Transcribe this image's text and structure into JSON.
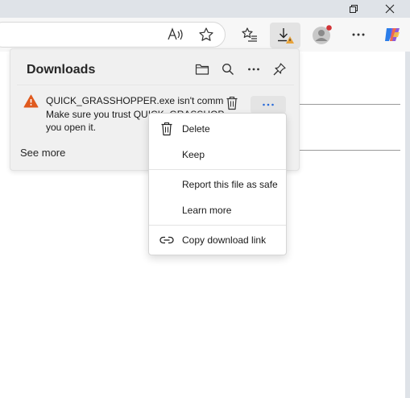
{
  "browser": {
    "toolbar_icons": [
      "read-aloud-icon",
      "favorite-star-icon",
      "favorites-collection-icon",
      "downloads-icon",
      "profile-avatar-icon",
      "more-menu-icon",
      "copilot-icon"
    ],
    "window_controls": [
      "restore-icon",
      "close-icon"
    ],
    "colors": {
      "warning_badge": "#e8a33a",
      "profile_dot": "#d13438",
      "accent": "#2b6cd9"
    }
  },
  "downloads_panel": {
    "title": "Downloads",
    "header_icons": [
      "open-folder-icon",
      "search-icon",
      "more-options-icon",
      "pin-icon"
    ],
    "item": {
      "message_line1": "QUICK_GRASSHOPPER.exe isn't commonl",
      "message_line2": "Make sure you trust QUICK_GRASSHOPPE",
      "message_line3": "you open it.",
      "status_icon": "warning-icon",
      "status_color": "#e05a1e"
    },
    "see_more": "See more"
  },
  "context_menu": {
    "delete": "Delete",
    "keep": "Keep",
    "report": "Report this file as safe",
    "learn_more": "Learn more",
    "copy_link": "Copy download link"
  }
}
